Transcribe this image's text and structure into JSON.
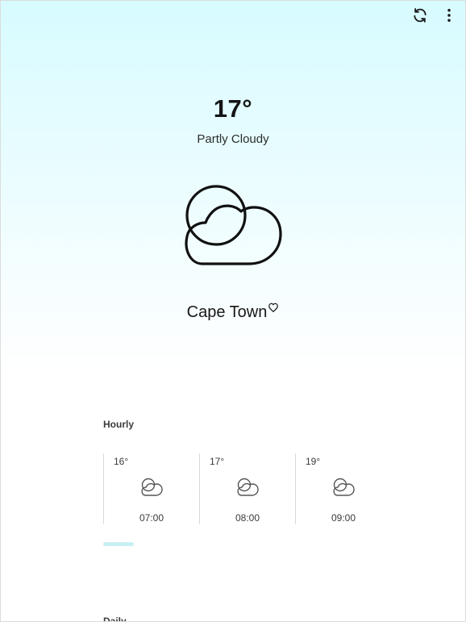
{
  "header": {
    "refresh_icon": "refresh-icon",
    "more_icon": "more-vertical-icon"
  },
  "current": {
    "temperature": "17°",
    "condition": "Partly Cloudy",
    "icon": "partly-cloudy-icon",
    "city": "Cape Town",
    "favorite_icon": "heart-outline-icon"
  },
  "hourly": {
    "label": "Hourly",
    "items": [
      {
        "temp": "16°",
        "time": "07:00",
        "icon": "partly-cloudy-icon"
      },
      {
        "temp": "17°",
        "time": "08:00",
        "icon": "partly-cloudy-icon"
      },
      {
        "temp": "19°",
        "time": "09:00",
        "icon": "partly-cloudy-icon"
      }
    ]
  },
  "daily": {
    "label": "Daily"
  },
  "colors": {
    "gradient_top": "#d7fbff",
    "scroll_indicator": "#c9eff4"
  }
}
